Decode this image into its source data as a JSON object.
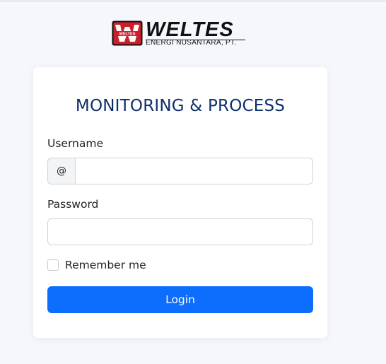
{
  "brand": {
    "mark_text": "WELTES",
    "name": "WELTES",
    "subtitle": "ENERGI NUSANTARA, PT."
  },
  "form": {
    "title": "MONITORING & PROCESS",
    "username_label": "Username",
    "username_prefix": "@",
    "username_value": "",
    "password_label": "Password",
    "password_value": "",
    "remember_label": "Remember me",
    "remember_checked": false,
    "login_label": "Login"
  },
  "colors": {
    "page_background": "#f5f7fc",
    "title": "#0d2f6b",
    "primary_button": "#0d6efd",
    "logo_red": "#cc1f2a"
  }
}
